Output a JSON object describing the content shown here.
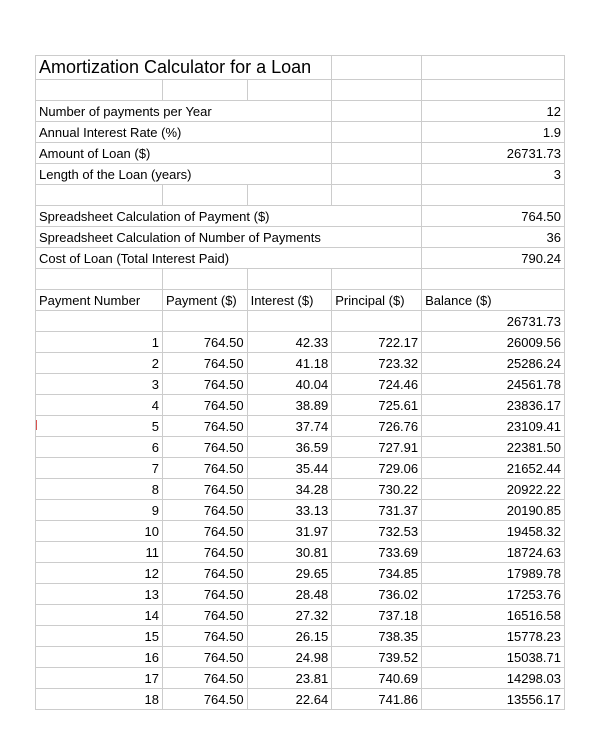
{
  "title": "Amortization Calculator for a Loan",
  "inputs": [
    {
      "label": "Number of payments per Year",
      "value": "12"
    },
    {
      "label": "Annual Interest Rate (%)",
      "value": "1.9"
    },
    {
      "label": "Amount of Loan ($)",
      "value": "26731.73"
    },
    {
      "label": "Length of the Loan (years)",
      "value": "3"
    }
  ],
  "calcs": [
    {
      "label": "Spreadsheet Calculation of Payment ($)",
      "value": "764.50"
    },
    {
      "label": "Spreadsheet Calculation of Number of Payments",
      "value": "36"
    },
    {
      "label": "Cost of Loan (Total Interest Paid)",
      "value": "790.24"
    }
  ],
  "headers": {
    "c1": "Payment Number",
    "c2": "Payment ($)",
    "c3": "Interest ($)",
    "c4": "Principal ($)",
    "c5": "Balance ($)"
  },
  "initial_balance": "26731.73",
  "rows": [
    {
      "n": "1",
      "payment": "764.50",
      "interest": "42.33",
      "principal": "722.17",
      "balance": "26009.56"
    },
    {
      "n": "2",
      "payment": "764.50",
      "interest": "41.18",
      "principal": "723.32",
      "balance": "25286.24"
    },
    {
      "n": "3",
      "payment": "764.50",
      "interest": "40.04",
      "principal": "724.46",
      "balance": "24561.78"
    },
    {
      "n": "4",
      "payment": "764.50",
      "interest": "38.89",
      "principal": "725.61",
      "balance": "23836.17"
    },
    {
      "n": "5",
      "payment": "764.50",
      "interest": "37.74",
      "principal": "726.76",
      "balance": "23109.41"
    },
    {
      "n": "6",
      "payment": "764.50",
      "interest": "36.59",
      "principal": "727.91",
      "balance": "22381.50"
    },
    {
      "n": "7",
      "payment": "764.50",
      "interest": "35.44",
      "principal": "729.06",
      "balance": "21652.44"
    },
    {
      "n": "8",
      "payment": "764.50",
      "interest": "34.28",
      "principal": "730.22",
      "balance": "20922.22"
    },
    {
      "n": "9",
      "payment": "764.50",
      "interest": "33.13",
      "principal": "731.37",
      "balance": "20190.85"
    },
    {
      "n": "10",
      "payment": "764.50",
      "interest": "31.97",
      "principal": "732.53",
      "balance": "19458.32"
    },
    {
      "n": "11",
      "payment": "764.50",
      "interest": "30.81",
      "principal": "733.69",
      "balance": "18724.63"
    },
    {
      "n": "12",
      "payment": "764.50",
      "interest": "29.65",
      "principal": "734.85",
      "balance": "17989.78"
    },
    {
      "n": "13",
      "payment": "764.50",
      "interest": "28.48",
      "principal": "736.02",
      "balance": "17253.76"
    },
    {
      "n": "14",
      "payment": "764.50",
      "interest": "27.32",
      "principal": "737.18",
      "balance": "16516.58"
    },
    {
      "n": "15",
      "payment": "764.50",
      "interest": "26.15",
      "principal": "738.35",
      "balance": "15778.23"
    },
    {
      "n": "16",
      "payment": "764.50",
      "interest": "24.98",
      "principal": "739.52",
      "balance": "15038.71"
    },
    {
      "n": "17",
      "payment": "764.50",
      "interest": "23.81",
      "principal": "740.69",
      "balance": "14298.03"
    },
    {
      "n": "18",
      "payment": "764.50",
      "interest": "22.64",
      "principal": "741.86",
      "balance": "13556.17"
    }
  ]
}
